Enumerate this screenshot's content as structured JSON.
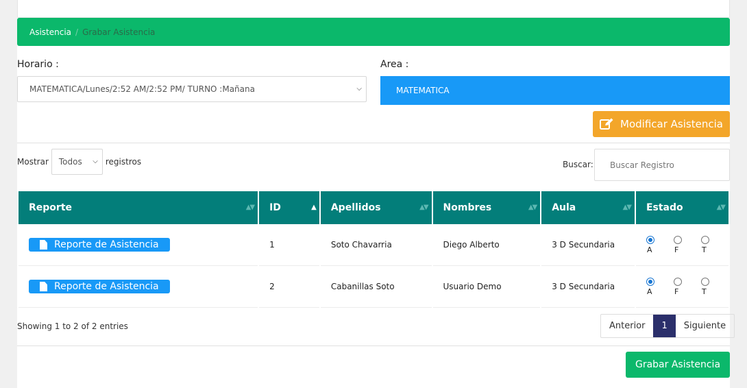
{
  "breadcrumb": {
    "parent": "Asistencia",
    "current": "Grabar Asistencia"
  },
  "horario": {
    "label": "Horario :",
    "value": "MATEMATICA/Lunes/2:52 AM/2:52 PM/ TURNO :Mañana"
  },
  "area": {
    "label": "Area :",
    "value": "MATEMATICA"
  },
  "modify_button": {
    "label": "Modificar Asistencia",
    "icon": "edit-icon"
  },
  "length_menu": {
    "prefix": "Mostrar",
    "value": "Todos",
    "suffix": "registros"
  },
  "search": {
    "label": "Buscar:",
    "placeholder": "Buscar Registro"
  },
  "table": {
    "headers": [
      "Reporte",
      "ID",
      "Apellidos",
      "Nombres",
      "Aula",
      "Estado"
    ],
    "rows": [
      {
        "report": "Reporte de Asistencia",
        "id": "1",
        "apellidos": "Soto Chavarria",
        "nombres": "Diego Alberto",
        "aula": "3 D Secundaria",
        "estado": "A"
      },
      {
        "report": "Reporte de Asistencia",
        "id": "2",
        "apellidos": "Cabanillas Soto",
        "nombres": "Usuario Demo",
        "aula": "3 D Secundaria",
        "estado": "A"
      }
    ],
    "estado_options": [
      "A",
      "F",
      "T"
    ]
  },
  "info": "Showing 1 to 2 of 2 entries",
  "pagination": {
    "prev": "Anterior",
    "page": "1",
    "next": "Siguiente"
  },
  "save_button": {
    "label": "Grabar Asistencia"
  },
  "colors": {
    "green": "#0bb86b",
    "teal_header": "#037e7a",
    "blue": "#1899f7",
    "orange": "#f3a62a",
    "pager_active": "#2b2f6b"
  }
}
